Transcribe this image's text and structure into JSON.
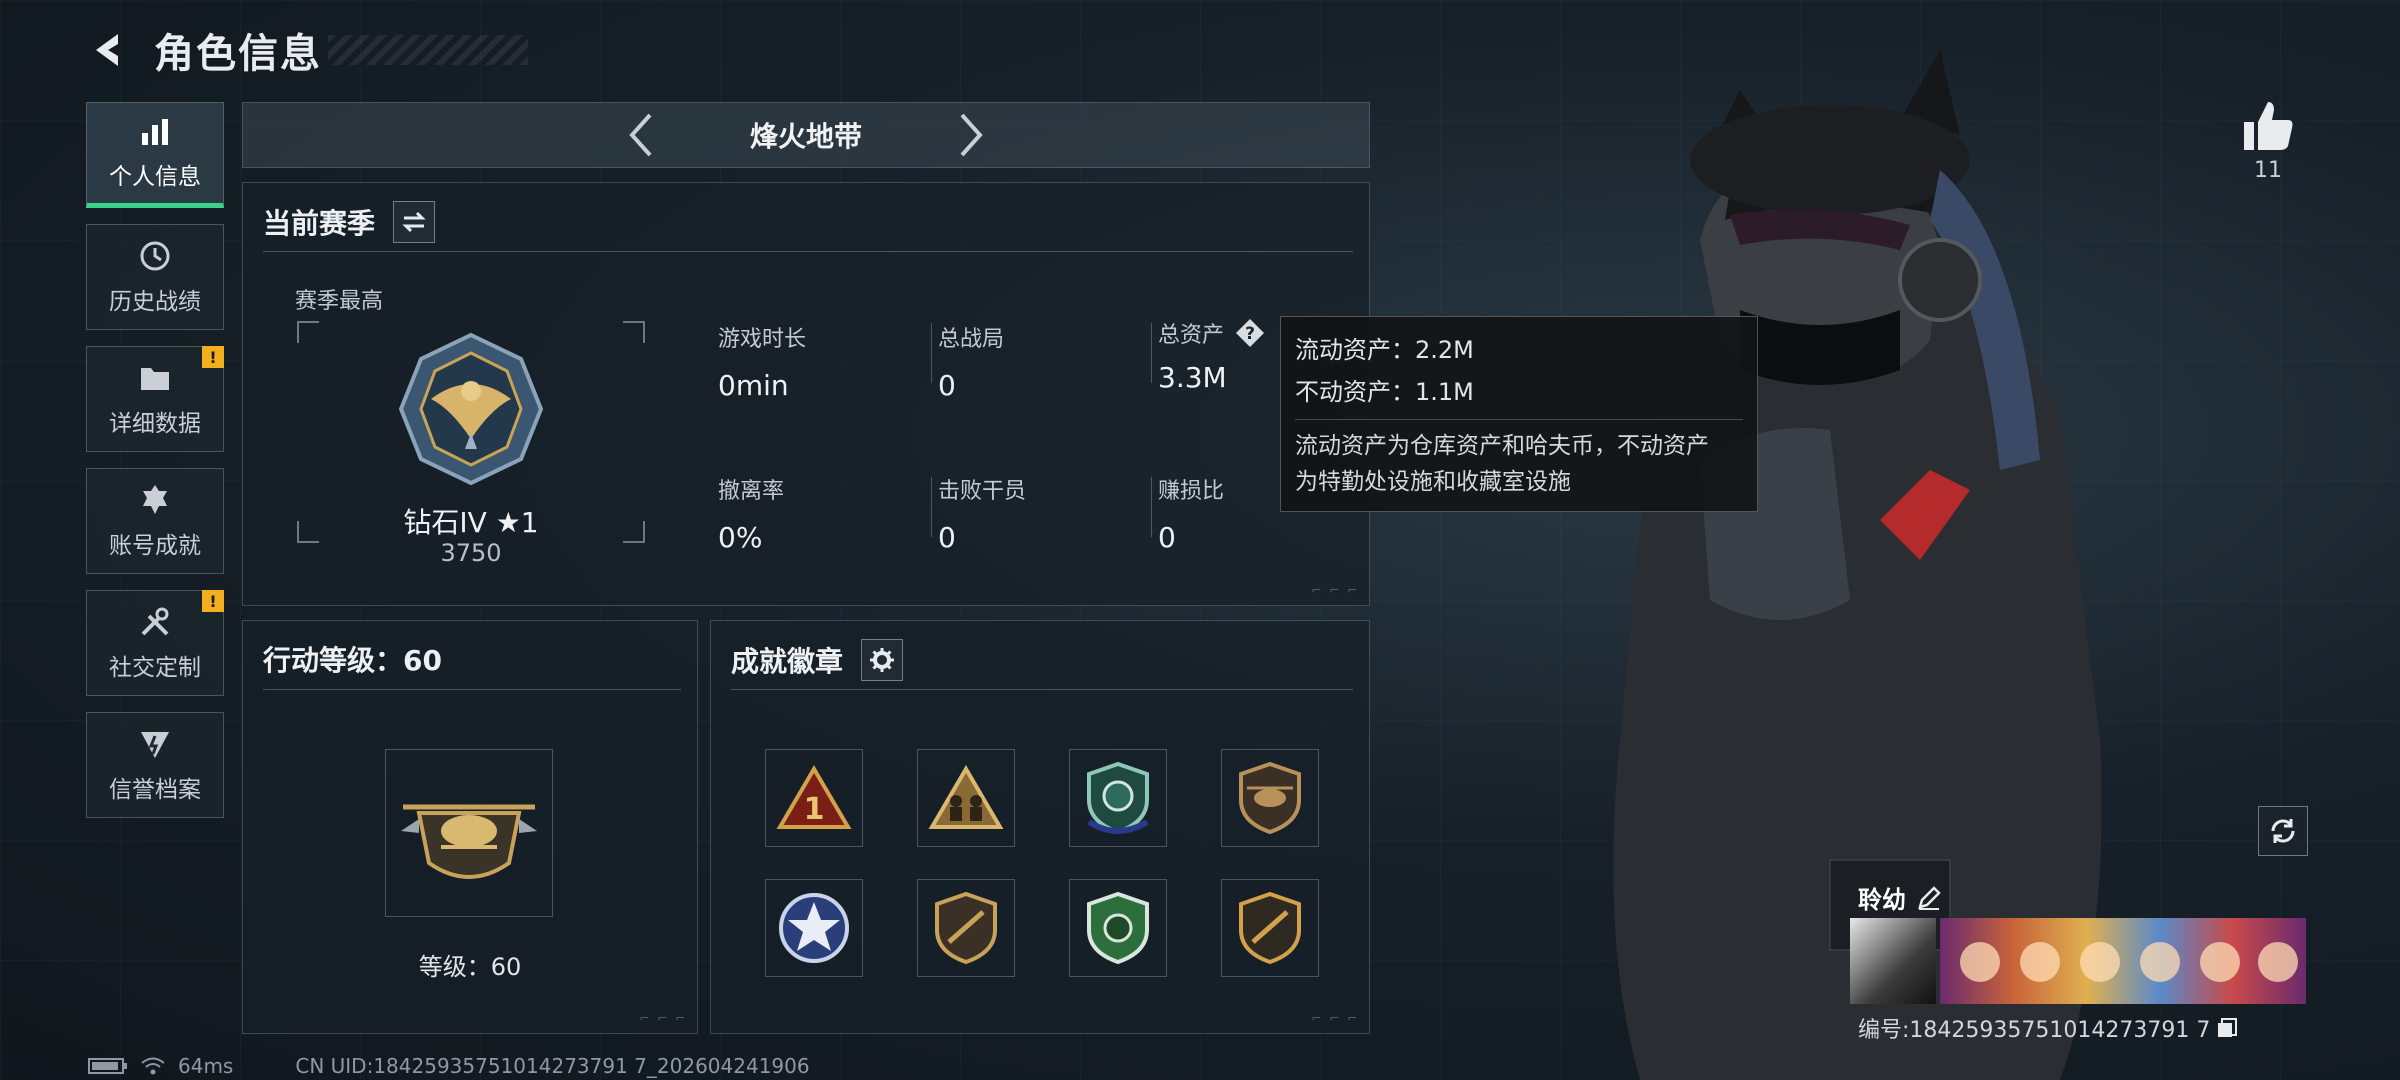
{
  "header": {
    "title": "角色信息"
  },
  "sidebar": {
    "items": [
      {
        "label": "个人信息",
        "active": true,
        "alert": false
      },
      {
        "label": "历史战绩",
        "active": false,
        "alert": false
      },
      {
        "label": "详细数据",
        "active": false,
        "alert": true
      },
      {
        "label": "账号成就",
        "active": false,
        "alert": false
      },
      {
        "label": "社交定制",
        "active": false,
        "alert": true
      },
      {
        "label": "信誉档案",
        "active": false,
        "alert": false
      }
    ],
    "alert_mark": "!"
  },
  "mode": {
    "title": "烽火地带"
  },
  "season": {
    "title": "当前赛季",
    "subtitle": "赛季最高",
    "rank_name": "钻石IV ★1",
    "rank_score": "3750",
    "stats": [
      {
        "label": "游戏时长",
        "value": "0min"
      },
      {
        "label": "总战局",
        "value": "0"
      },
      {
        "label": "总资产",
        "value": "3.3M"
      },
      {
        "label": "撤离率",
        "value": "0%"
      },
      {
        "label": "击败干员",
        "value": "0"
      },
      {
        "label": "赚损比",
        "value": "0"
      }
    ]
  },
  "tooltip": {
    "liquid": "流动资产：2.2M",
    "fixed": "不动资产：1.1M",
    "desc_line1": "流动资产为仓库资产和哈夫币，不动资产",
    "desc_line2": "为特勤处设施和收藏室设施"
  },
  "action_level": {
    "title": "行动等级：60",
    "level_text": "等级：60"
  },
  "medals": {
    "title": "成就徽章"
  },
  "profile": {
    "likes": "11",
    "nickname": "聆幼",
    "uid": "编号:18425935751014273791 7"
  },
  "status": {
    "ping": "64ms",
    "cn_uid": "CN UID:18425935751014273791 7_202604241906"
  },
  "colors": {
    "accent": "#3ad18a",
    "alert": "#f2b01e"
  }
}
